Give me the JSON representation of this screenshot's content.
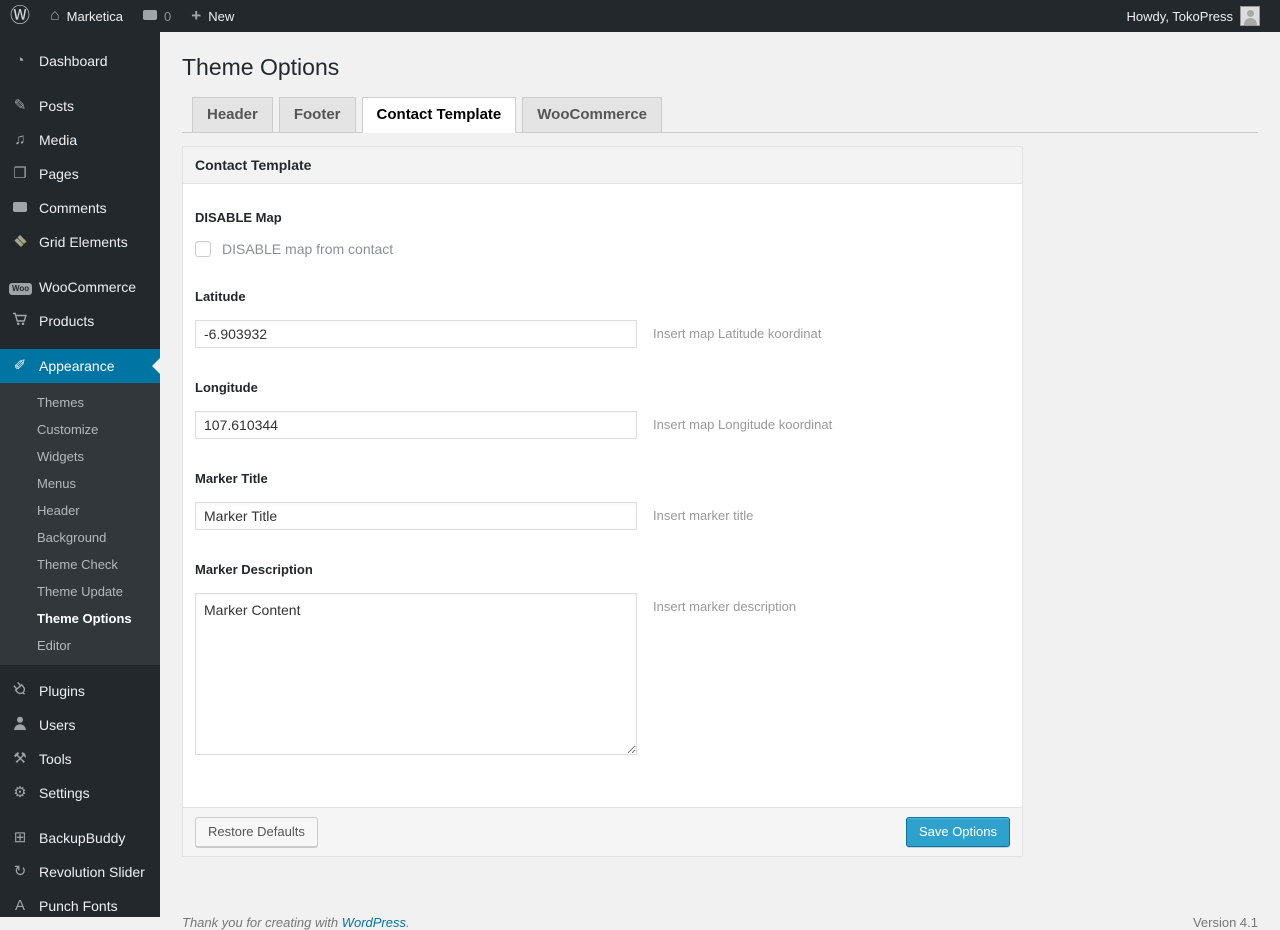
{
  "colors": {
    "accent": "#0074a2",
    "primary_button": "#2ea2cc",
    "admin_bar_bg": "#23282d",
    "page_bg": "#f1f1f1"
  },
  "admin_bar": {
    "site_name": "Marketica",
    "comment_count": "0",
    "new_label": "New",
    "howdy": "Howdy, TokoPress",
    "icons": [
      "wordpress-logo-icon",
      "home-icon",
      "comments-bubble-icon",
      "plus-icon",
      "avatar"
    ]
  },
  "sidebar": {
    "items": [
      {
        "label": "Dashboard",
        "icon": "dashboard-icon"
      },
      {
        "label": "Posts",
        "icon": "pushpin-icon"
      },
      {
        "label": "Media",
        "icon": "media-icon"
      },
      {
        "label": "Pages",
        "icon": "pages-icon"
      },
      {
        "label": "Comments",
        "icon": "comment-icon"
      },
      {
        "label": "Grid Elements",
        "icon": "grid-elements-icon"
      },
      {
        "label": "WooCommerce",
        "icon": "woocommerce-icon"
      },
      {
        "label": "Products",
        "icon": "cart-icon"
      },
      {
        "label": "Appearance",
        "icon": "appearance-brush-icon",
        "active": true
      },
      {
        "label": "Plugins",
        "icon": "plugin-icon"
      },
      {
        "label": "Users",
        "icon": "user-icon"
      },
      {
        "label": "Tools",
        "icon": "tools-icon"
      },
      {
        "label": "Settings",
        "icon": "settings-icon"
      },
      {
        "label": "BackupBuddy",
        "icon": "backup-icon"
      },
      {
        "label": "Revolution Slider",
        "icon": "rotate-icon"
      },
      {
        "label": "Punch Fonts",
        "icon": "letter-a-icon"
      }
    ],
    "submenu": {
      "items": [
        {
          "label": "Themes"
        },
        {
          "label": "Customize"
        },
        {
          "label": "Widgets"
        },
        {
          "label": "Menus"
        },
        {
          "label": "Header"
        },
        {
          "label": "Background"
        },
        {
          "label": "Theme Check"
        },
        {
          "label": "Theme Update"
        },
        {
          "label": "Theme Options",
          "active": true
        },
        {
          "label": "Editor"
        }
      ]
    }
  },
  "main": {
    "title": "Theme Options",
    "tabs": [
      {
        "label": "Header",
        "active": false
      },
      {
        "label": "Footer",
        "active": false
      },
      {
        "label": "Contact Template",
        "active": true
      },
      {
        "label": "WooCommerce",
        "active": false
      }
    ]
  },
  "panel": {
    "title": "Contact Template",
    "fields": {
      "disable_map": {
        "label": "DISABLE Map",
        "checkbox_label": "DISABLE map from contact",
        "checked": false
      },
      "latitude": {
        "label": "Latitude",
        "value": "-6.903932",
        "hint": "Insert map Latitude koordinat"
      },
      "longitude": {
        "label": "Longitude",
        "value": "107.610344",
        "hint": "Insert map Longitude koordinat"
      },
      "marker_title": {
        "label": "Marker Title",
        "value": "Marker Title",
        "hint": "Insert marker title"
      },
      "marker_description": {
        "label": "Marker Description",
        "value": "Marker Content",
        "hint": "Insert marker description"
      }
    },
    "buttons": {
      "restore": "Restore Defaults",
      "save": "Save Options"
    }
  },
  "page_footer": {
    "thanks_prefix": "Thank you for creating with ",
    "link_text": "WordPress",
    "suffix": ".",
    "version": "Version 4.1"
  }
}
